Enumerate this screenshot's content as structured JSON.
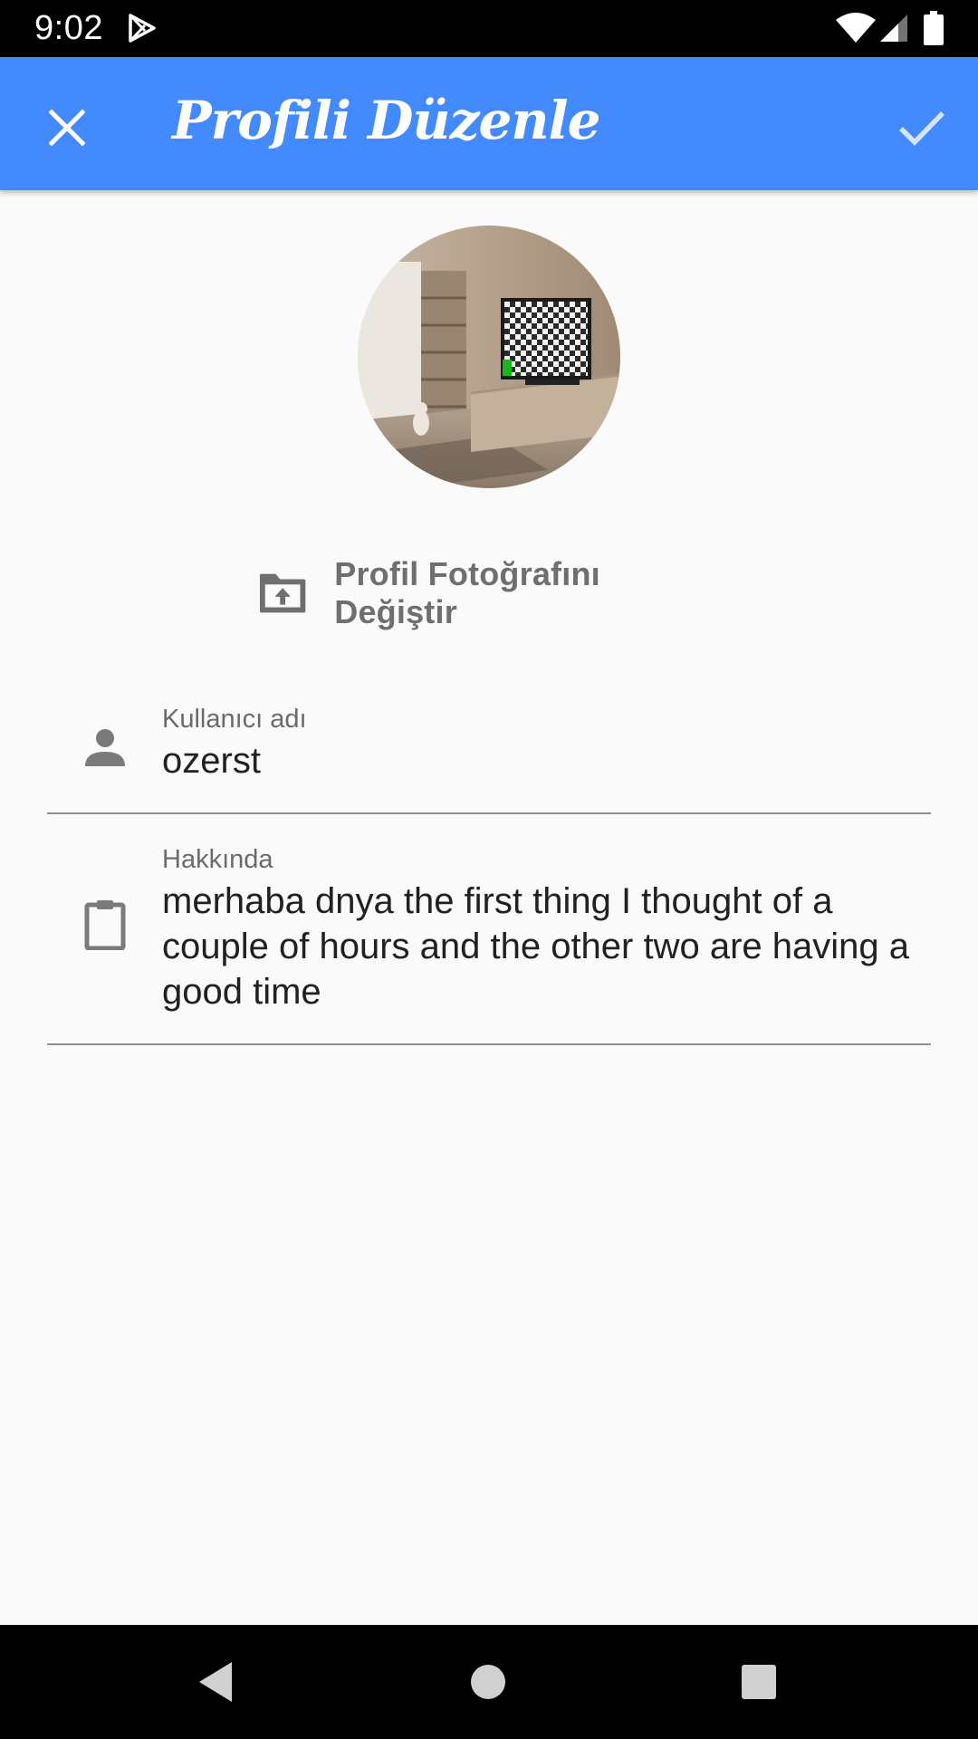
{
  "status_bar": {
    "time": "9:02",
    "icons": [
      "play-store-icon",
      "wifi-icon",
      "cell-signal-icon",
      "battery-icon"
    ]
  },
  "app_bar": {
    "title": "Profili Düzenle",
    "close_icon": "close-icon",
    "confirm_icon": "check-icon",
    "background": "#448aff"
  },
  "profile": {
    "avatar_icon": "profile-photo",
    "change_photo_label": "Profil Fotoğrafını Değiştir",
    "change_photo_icon": "folder-upload-icon"
  },
  "form": {
    "username": {
      "label": "Kullanıcı adı",
      "value": "ozerst",
      "icon": "person-icon"
    },
    "about": {
      "label": "Hakkında",
      "value": "merhaba dnya the first thing I thought of a couple of hours and the other two are having a good time",
      "icon": "clipboard-icon"
    }
  },
  "nav_bar": {
    "buttons": [
      "back-icon",
      "home-icon",
      "recents-icon"
    ]
  }
}
